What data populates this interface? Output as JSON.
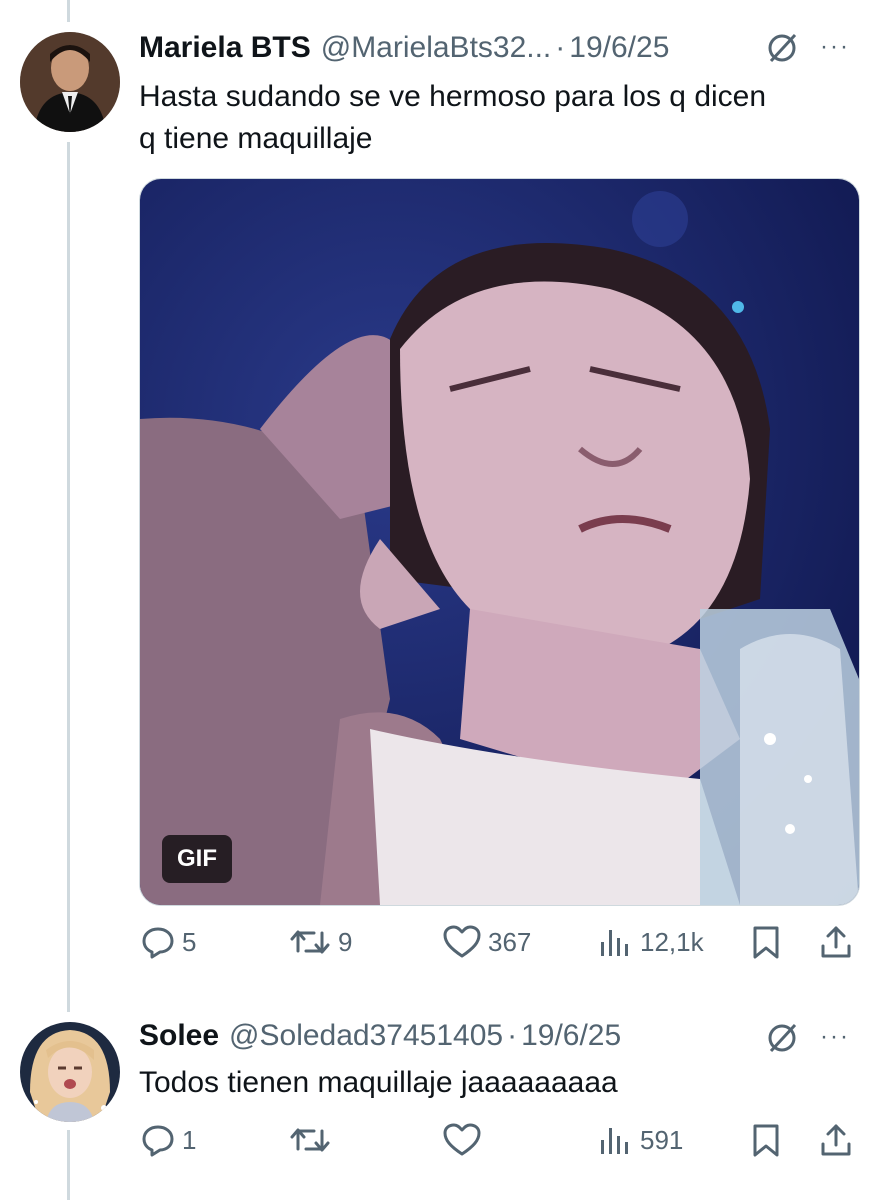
{
  "tweets": [
    {
      "display_name": "Mariela BTS",
      "handle": "@MarielaBts32...",
      "separator": "·",
      "date": "19/6/25",
      "more": "···",
      "text_lines": [
        "Hasta sudando se ve hermoso para los q dicen",
        "q tiene maquillaje"
      ],
      "media": {
        "badge": "GIF"
      },
      "actions": {
        "replies": "5",
        "reposts": "9",
        "likes": "367",
        "views": "12,1k"
      }
    },
    {
      "display_name": "Solee",
      "handle": "@Soledad37451405",
      "separator": "·",
      "date": "19/6/25",
      "more": "···",
      "text": "Todos tienen maquillaje jaaaaaaaaa",
      "actions": {
        "replies": "1",
        "reposts": "",
        "likes": "",
        "views": "591"
      }
    }
  ],
  "icons": [
    "reply-icon",
    "repost-icon",
    "like-icon",
    "views-icon",
    "bookmark-icon",
    "share-icon",
    "grok-icon"
  ],
  "colors": {
    "text": "#0f1419",
    "secondary": "#536471",
    "thread_line": "#cfd9de"
  }
}
